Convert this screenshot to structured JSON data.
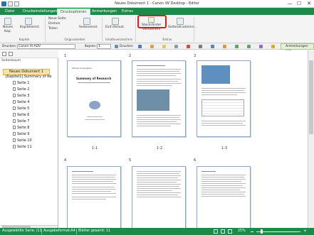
{
  "window": {
    "title": "Neues Dokument 1 - Canon iW Desktop - Editor",
    "minimize": "—",
    "maximize": "☐",
    "close": "✕"
  },
  "menu": {
    "tabs": [
      {
        "label": "Datei"
      },
      {
        "label": "Druckeinstellungen"
      },
      {
        "label": "Druckoptionen"
      },
      {
        "label": "Anmerkungen"
      },
      {
        "label": "Extras"
      }
    ],
    "active_index": 2
  },
  "ribbon": {
    "groups": {
      "kapitel": "Kapitel",
      "originalseiten": "Originalseiten",
      "inhaltsverzeichnis": "Inhaltsverzeichnis",
      "extras": "Extras"
    },
    "neues_kapitel_1": "Neues",
    "neues_kapitel_2": "Kap.",
    "kapiteleinst": "Kapiteleinst.",
    "neue_seite": "Neue Seite",
    "drehen": "Drehen",
    "teilen": "Teilen",
    "seiteneinst": "Seiteneinst.",
    "einf_aktual": "Einf./Aktual.",
    "stockrander_1": "Stockränder",
    "stockrander_2": "verkleinern",
    "seitendruckeinst": "Seitendruckeinst."
  },
  "toolbar": {
    "drucken_label": "Drucken:",
    "printer_value": "Canon iR-ADV",
    "kopien_label": "Kopien:",
    "kopien_value": "1",
    "drucken_button": "Drucken",
    "anmerkungen_anz": "Anmerkungen anz."
  },
  "sidebar": {
    "root_label": "Neues Dokument 1",
    "chapter_label": "[Kapitel1] Summary of Re",
    "pages": [
      "Seite 1",
      "Seite 2",
      "Seite 3",
      "Seite 4",
      "Seite 5",
      "Seite 6",
      "Seite 7",
      "Seite 8",
      "Seite 9",
      "Seite 10",
      "Seite 11"
    ],
    "panel_label": "Seitenbaum"
  },
  "pages": {
    "row1": [
      {
        "num": "1",
        "label": "1-1"
      },
      {
        "num": "2",
        "label": "1-2"
      },
      {
        "num": "3",
        "label": "1-3"
      }
    ],
    "row2": [
      {
        "num": "4"
      },
      {
        "num": "5"
      },
      {
        "num": "6"
      }
    ],
    "page1_heading": "Summary of Research",
    "page1_company": "Ohsea Corporation"
  },
  "status": {
    "selected_series": "Ausgewählte Serie: /11",
    "output_format": "Ausgabeformat:A4",
    "sheets_total": "Blätter gesamt: 11",
    "zoom": "25%"
  },
  "colors": {
    "accent": "#1e8a49",
    "highlight": "#e01b1b"
  }
}
